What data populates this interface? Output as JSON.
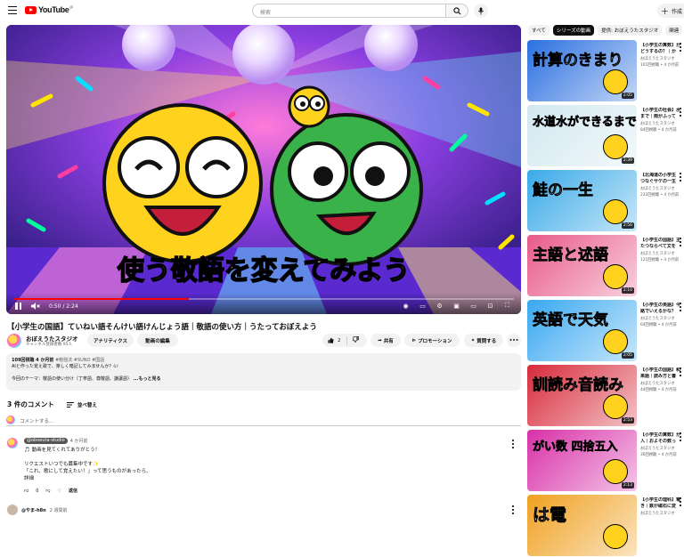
{
  "header": {
    "logo_text": "YouTube",
    "logo_region": "JP",
    "search_placeholder": "検索",
    "create_label": "作成"
  },
  "player": {
    "overlay_caption": "使う敬語を変えてみよう",
    "time": "0:50 / 2:24",
    "progress": 0.35
  },
  "video": {
    "title": "【小学生の国語】ていねい語そんけい語けんじょう語｜敬語の使い方｜うたっておぼえよう",
    "channel_name": "おぼえうたスタジオ",
    "subscribers": "チャンネル登録者数 95人",
    "analytics_label": "アナリティクス",
    "edit_label": "動画の編集",
    "like_count": "2",
    "share_label": "共有",
    "promote_label": "プロモーション",
    "thanks_label": "質問する"
  },
  "description": {
    "meta": "109回視聴  4 か月前",
    "tags": " #勉強法 #SUNO #国語",
    "line1": "AIと作った覚え歌で、楽しく暗記してみませんか？🎶",
    "line2": "今回のテーマ：敬語の使い分け（丁寧語、尊敬語、謙譲語）",
    "more": " ...もっと見る"
  },
  "comments": {
    "count_label": "3 件のコメント",
    "sort_label": "並べ替え",
    "add_placeholder": "コメントする...",
    "first": {
      "author": "@oboeuta-studio",
      "time": "4 か月前",
      "line1": "🎵 動画を見てくれてありがとう！",
      "line2": "リクエストいつでも募集中です✨",
      "line3": "「これ、歌にして覚えたい！」って思うものがあったら、",
      "read_more": "詳細",
      "like_count": "0",
      "reply_label": "返信"
    },
    "second": {
      "author": "@やま-h8n",
      "time": "2 週間前"
    }
  },
  "sidebar": {
    "chips": [
      "すべて",
      "シリーズの動画",
      "提供: おぼえうたスタジオ",
      "関連"
    ],
    "items": [
      {
        "thumb_text": "計算のきまり",
        "duration": "2:05",
        "title1": "【小学生の算数】か",
        "title2": "どうするの？｜か",
        "channel": "おぼえうたスタジオ",
        "meta": "101回視聴 • 4 か月前",
        "bg": "#2a6fe0"
      },
      {
        "thumb_text": "水道水ができるまで",
        "duration": "2:39",
        "title1": "【小学生の社会】水",
        "title2": "まで｜雨がふって",
        "channel": "おぼえうたスタジオ",
        "meta": "84回視聴 • 4 か月前",
        "bg": "#d2e8f0"
      },
      {
        "thumb_text": "鮭の一生",
        "duration": "2:56",
        "title1": "【北海道の小学生",
        "title2": "つなぐサケの一生",
        "channel": "おぼえうたスタジオ",
        "meta": "232回視聴 • 4 か月前",
        "bg": "#3aa9e8"
      },
      {
        "thumb_text": "主語と述語",
        "duration": "2:10",
        "title1": "【小学生の国語】主",
        "title2": "たつならべて文を",
        "channel": "おぼえうたスタジオ",
        "meta": "121回視聴 • 4 か月前",
        "bg": "#e85a8a"
      },
      {
        "thumb_text": "英語で天気",
        "duration": "2:05",
        "title1": "【小学生の英語】今",
        "title2": "路でいえるかな？",
        "channel": "おぼえうたスタジオ",
        "meta": "64回視聴 • 4 か月前",
        "bg": "#39a8f0"
      },
      {
        "thumb_text": "訓読み音読み",
        "duration": "2:53",
        "title1": "【小学生の国語】和",
        "title2": "来語｜読み方と書",
        "channel": "おぼえうたスタジオ",
        "meta": "44回視聴 • 4 か月前",
        "bg": "#d72a3a"
      },
      {
        "thumb_text": "がい数 四捨五入",
        "duration": "2:13",
        "title1": "【小学生の算数】が",
        "title2": "入｜およその数っ",
        "channel": "おぼえうたスタジオ",
        "meta": "36回視聴 • 4 か月前",
        "bg": "#d830a8"
      },
      {
        "thumb_text": "は電",
        "duration": "",
        "title1": "【小学生の理科】電",
        "title2": "き｜鉄が磁石に変",
        "channel": "おぼえうたスタジオ",
        "meta": "",
        "bg": "#f0a020"
      }
    ]
  }
}
